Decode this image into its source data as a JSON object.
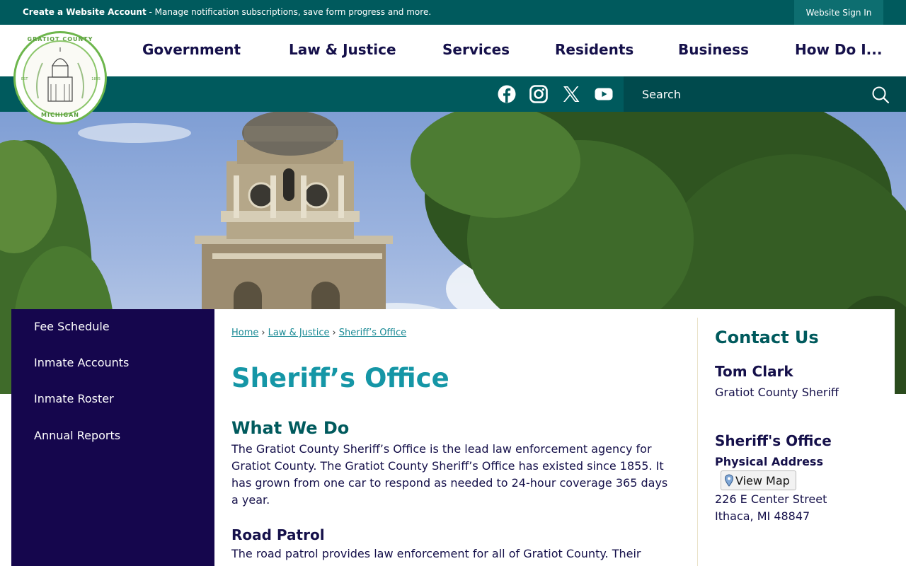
{
  "topbar": {
    "create_account_label": "Create a Website Account",
    "create_account_desc": " - Manage notification subscriptions, save form progress and more.",
    "signin_label": "Website Sign In"
  },
  "logo": {
    "text_top": "GRATIOT COUNTY",
    "text_bottom": "MICHIGAN",
    "est_left": "EST",
    "year_right": "1855"
  },
  "nav": {
    "items": [
      {
        "label": "Government"
      },
      {
        "label": "Law & Justice"
      },
      {
        "label": "Services"
      },
      {
        "label": "Residents"
      },
      {
        "label": "Business"
      },
      {
        "label": "How Do I..."
      }
    ]
  },
  "social": {
    "icons": [
      "facebook-icon",
      "instagram-icon",
      "x-twitter-icon",
      "youtube-icon"
    ]
  },
  "search": {
    "placeholder": "Search"
  },
  "sidebar": {
    "items": [
      {
        "label": "Fee Schedule"
      },
      {
        "label": "Inmate Accounts"
      },
      {
        "label": "Inmate Roster"
      },
      {
        "label": "Annual Reports"
      }
    ]
  },
  "breadcrumb": {
    "items": [
      {
        "label": "Home"
      },
      {
        "label": "Law & Justice"
      },
      {
        "label": "Sheriff’s Office"
      }
    ],
    "separator": "›"
  },
  "main": {
    "title": "Sheriff’s Office",
    "section1_heading": "What We Do",
    "section1_text": "The Gratiot County Sheriff’s Office is the lead law enforcement agency for Gratiot County. The Gratiot County Sheriff’s Office has existed since 1855. It has grown from one car to respond as needed to 24-hour coverage 365 days a year.",
    "section2_heading": "Road Patrol",
    "section2_text": "The road patrol provides law enforcement for all of Gratiot County. Their"
  },
  "contact": {
    "title": "Contact Us",
    "name": "Tom Clark",
    "role": "Gratiot County Sheriff",
    "office_heading": "Sheriff's Office",
    "address_label": "Physical Address",
    "map_button": "View Map",
    "street": "226 E Center Street",
    "city": "Ithaca, MI 48847"
  },
  "colors": {
    "teal_dark": "#005a5d",
    "navy": "#15064d",
    "title_teal": "#1596a6",
    "logo_green": "#6db64c"
  }
}
